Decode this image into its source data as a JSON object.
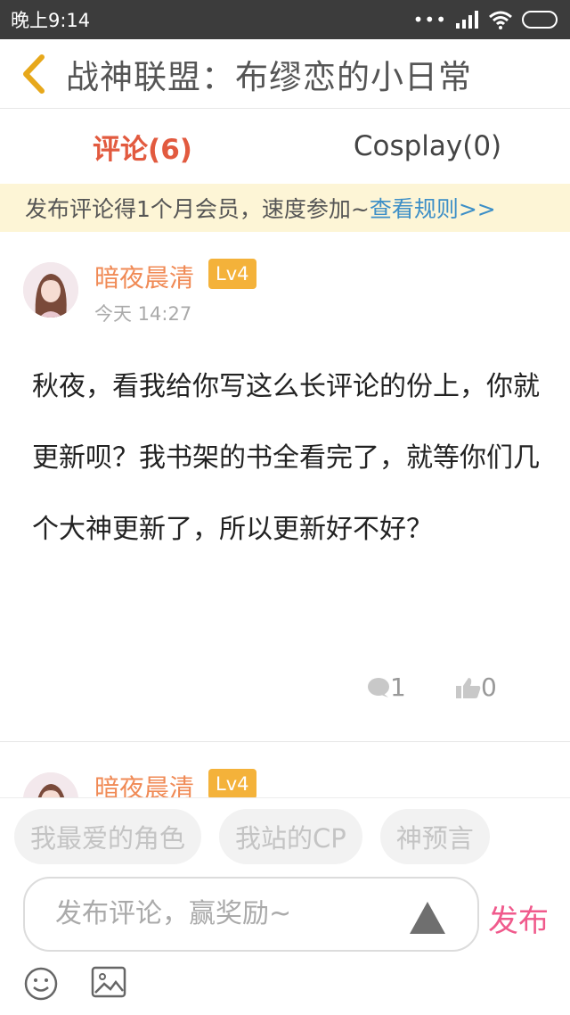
{
  "status_bar": {
    "time": "晚上9:14",
    "dots": "•••"
  },
  "header": {
    "title": "战神联盟：布缪恋的小日常"
  },
  "tabs": [
    {
      "label": "评论(6)",
      "active": true
    },
    {
      "label": "Cosplay(0)",
      "active": false
    }
  ],
  "notice": {
    "text": "发布评论得1个月会员，速度参加~",
    "link": "查看规则>>"
  },
  "comments": [
    {
      "username": "暗夜晨清",
      "level": "Lv4",
      "time": "今天 14:27",
      "body": "秋夜，看我给你写这么长评论的份上，你就更新呗？我书架的书全看完了，就等你们几个大神更新了，所以更新好不好？",
      "reply_count": "1",
      "like_count": "0"
    },
    {
      "username": "暗夜晨清",
      "level": "Lv4"
    }
  ],
  "bottom": {
    "chips": [
      "我最爱的角色",
      "我站的CP",
      "神预言"
    ],
    "input_placeholder": "发布评论，赢奖励~",
    "publish_label": "发布"
  },
  "icons": {
    "back": "back-chevron-icon",
    "reply": "comment-bubble-icon",
    "like": "thumbs-up-icon",
    "send": "send-arrow-icon",
    "emoji": "emoji-icon",
    "image": "image-icon",
    "wifi": "wifi-icon",
    "signal": "signal-icon",
    "battery": "battery-icon"
  },
  "colors": {
    "accent": "#e25a3f",
    "username": "#f08a55",
    "level_badge": "#f4b23a",
    "notice_bg": "#fdf5d6",
    "link": "#3d8fc7",
    "publish": "#f05a8c"
  }
}
